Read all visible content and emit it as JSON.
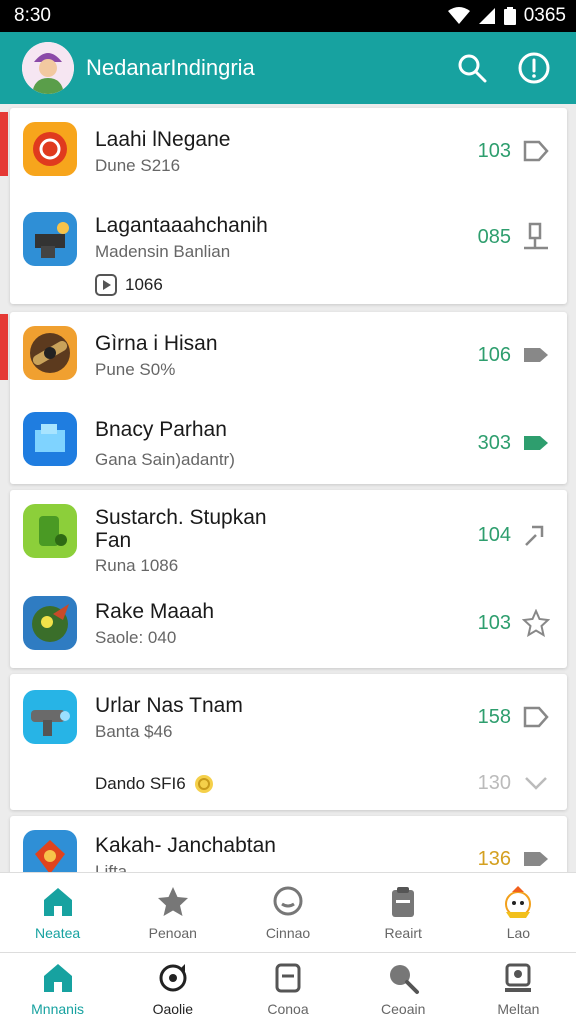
{
  "status_bar": {
    "time": "8:30",
    "battery_text": "0365"
  },
  "app_bar": {
    "title": "NedanarIndingria",
    "avatar_icon": "user-avatar-icon",
    "search_icon": "search-icon",
    "info_icon": "info-icon"
  },
  "colors": {
    "primary": "#17a2a0",
    "accent_green": "#2e9e6e",
    "marker_red": "#e53935"
  },
  "items": [
    {
      "name": "Laahi lNegane",
      "sub": "Dune S216",
      "value": "103",
      "icon": "red-circle-app-icon",
      "action_icon": "tag-icon"
    },
    {
      "name": "Lagantaaahchanih",
      "sub": "Madensin Banlian",
      "value": "085",
      "meta": "1066",
      "icon": "anvil-app-icon",
      "action_icon": "stack-icon"
    },
    {
      "name": "Gìrna i Hisan",
      "sub": "Pune S0%",
      "value": "106",
      "icon": "cannon-app-icon",
      "action_icon": "label-icon"
    },
    {
      "name": "Bnacy Parhan",
      "sub": "Gana Sain)adantr)",
      "value": "303",
      "icon": "blue-tiles-app-icon",
      "action_icon": "label-icon"
    },
    {
      "name": "Sustarch. Stupkan",
      "name2": "Fan",
      "sub": "Runa 1086",
      "value": "104",
      "icon": "green-cup-app-icon",
      "action_icon": "link-icon"
    },
    {
      "name": "Rake Maaah",
      "sub": "Saole: 040",
      "value": "103",
      "icon": "dragon-app-icon",
      "action_icon": "star-outline-icon"
    },
    {
      "name": "Urlar Nas Tnam",
      "sub": "Banta  $46",
      "value": "158",
      "meta": "Dando SFI6",
      "meta2": "130",
      "icon": "blaster-app-icon",
      "action_icon": "tag-icon"
    },
    {
      "name": "Kakah- Janchabtan",
      "sub": "Lifta",
      "value": "136",
      "icon": "gem-app-icon",
      "action_icon": "label-icon"
    }
  ],
  "nav_top": [
    {
      "label": "Neatea",
      "icon": "home-icon"
    },
    {
      "label": "Penoan",
      "icon": "star-icon"
    },
    {
      "label": "Cinnao",
      "icon": "chat-icon"
    },
    {
      "label": "Reairt",
      "icon": "clipboard-icon"
    },
    {
      "label": "Lao",
      "icon": "mascot-icon"
    }
  ],
  "nav_bottom": [
    {
      "label": "Mnnanis",
      "icon": "home-icon"
    },
    {
      "label": "Oaolie",
      "icon": "refresh-icon"
    },
    {
      "label": "Conoa",
      "icon": "card-icon"
    },
    {
      "label": "Ceoain",
      "icon": "search-icon"
    },
    {
      "label": "Meltan",
      "icon": "profile-icon"
    }
  ]
}
